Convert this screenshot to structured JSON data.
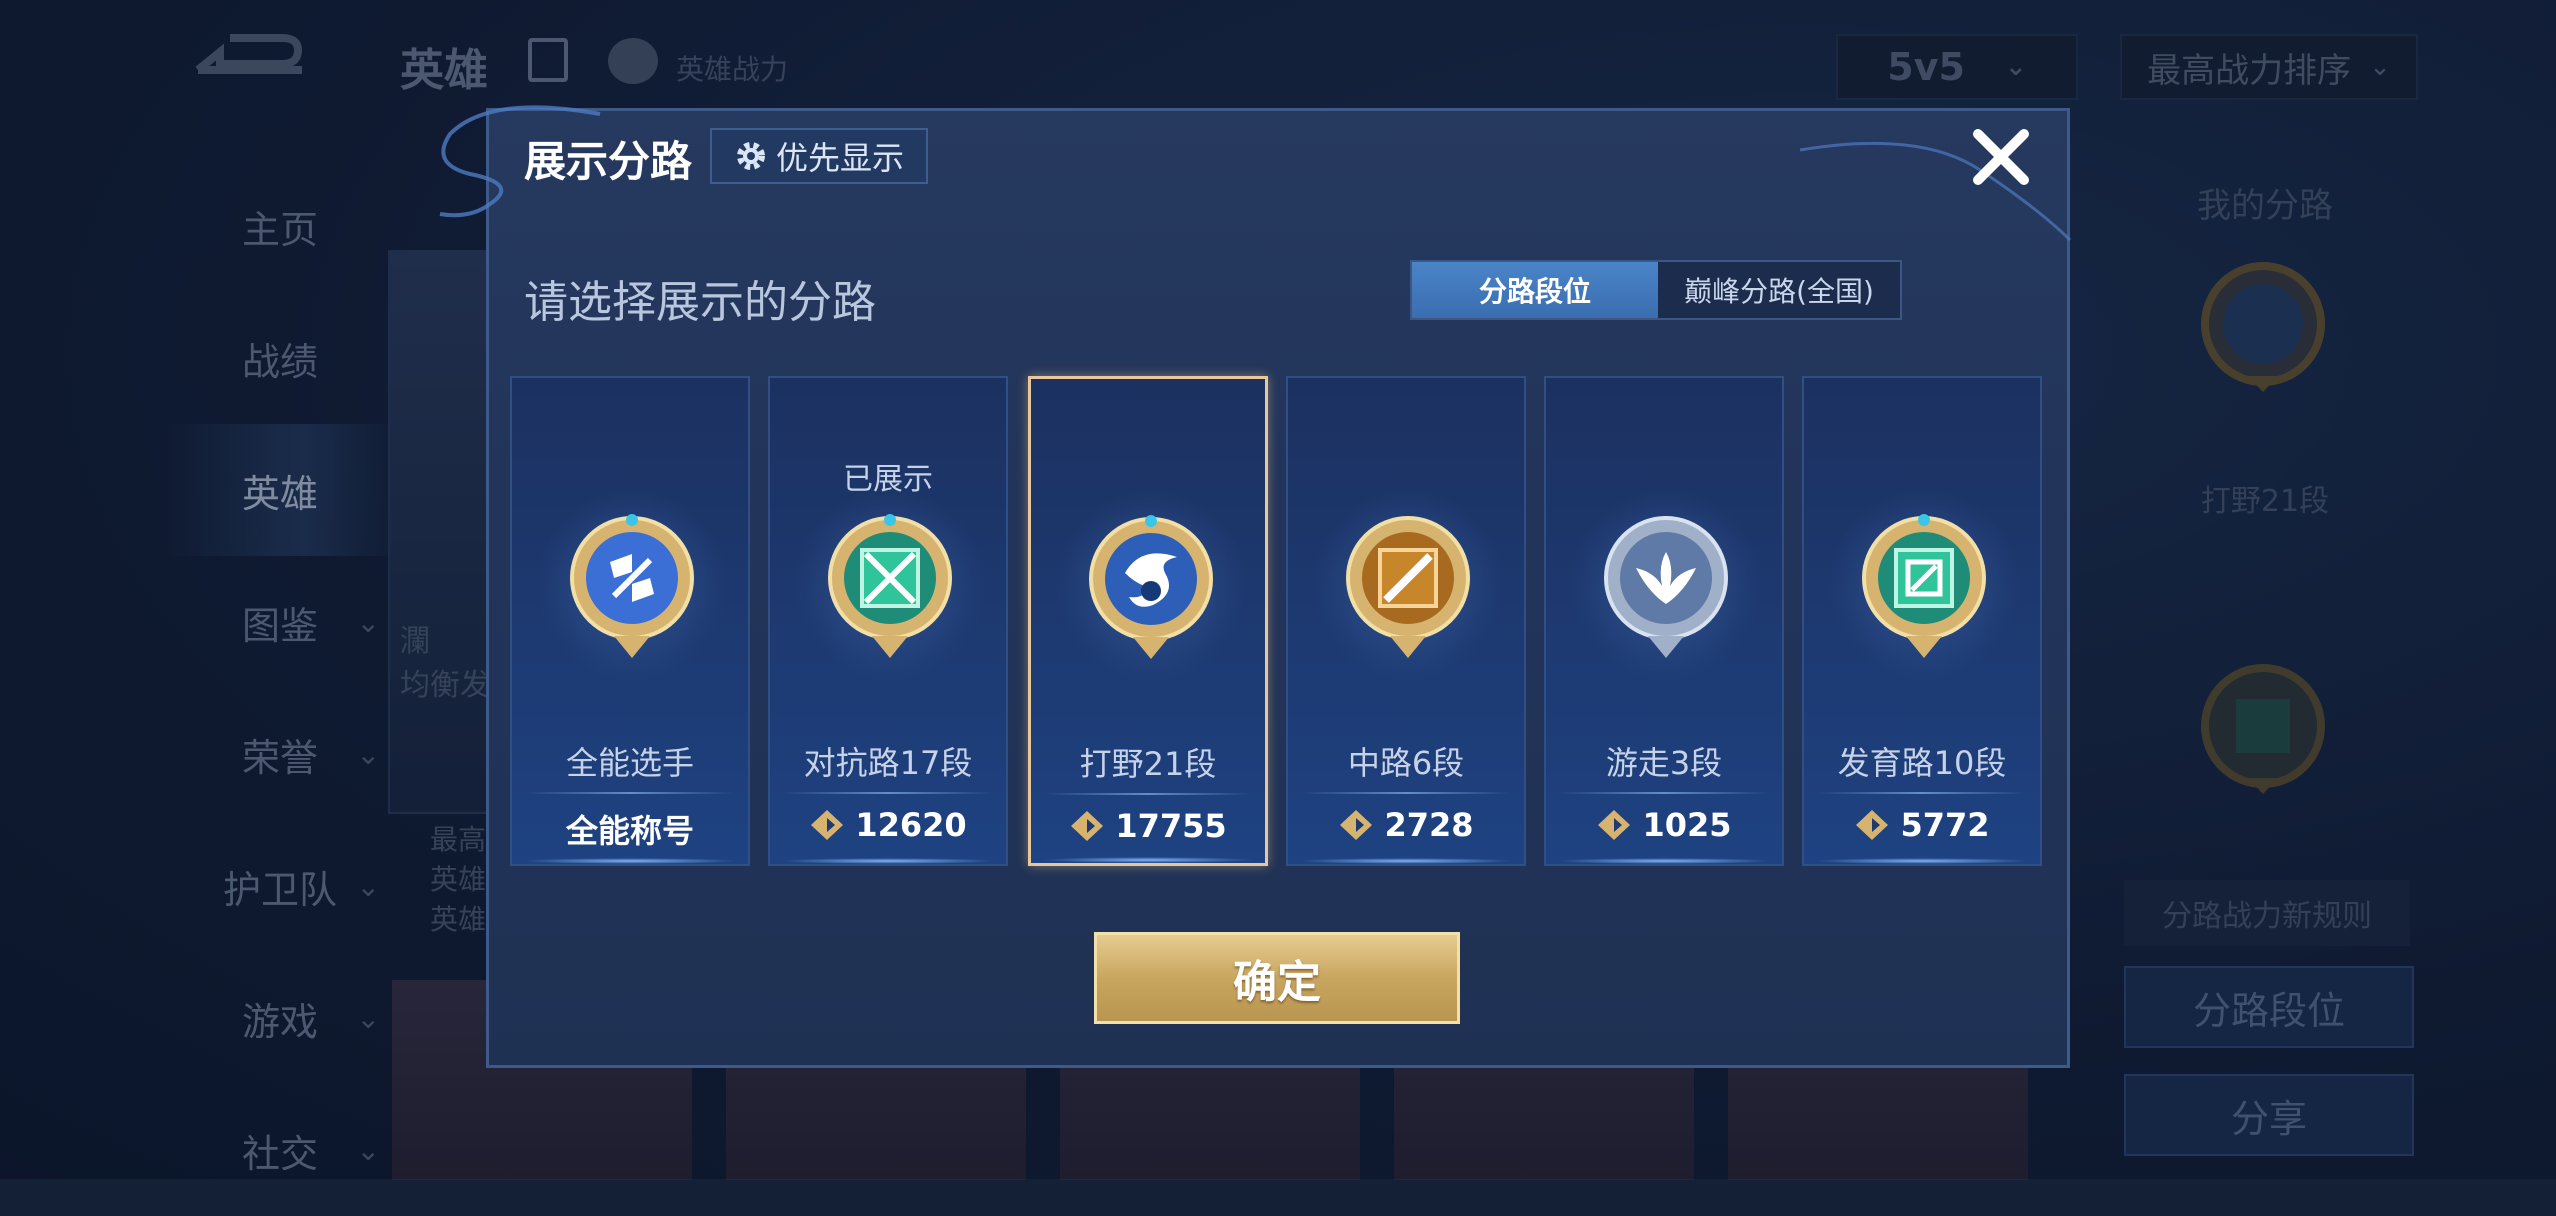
{
  "background": {
    "title": "英雄",
    "power_label": "英雄战力",
    "nav": [
      {
        "label": "主页",
        "chevron": false
      },
      {
        "label": "战绩",
        "chevron": false
      },
      {
        "label": "英雄",
        "chevron": false,
        "active": true
      },
      {
        "label": "图鉴",
        "chevron": true
      },
      {
        "label": "荣誉",
        "chevron": true
      },
      {
        "label": "护卫队",
        "chevron": true
      },
      {
        "label": "游戏",
        "chevron": true
      },
      {
        "label": "社交",
        "chevron": true
      }
    ],
    "mode_select": "5v5",
    "sort_select": "最高战力排序",
    "right_panel": {
      "title": "我的分路",
      "lane": "打野21段",
      "rule": "分路战力新规则",
      "lane_rank_button": "分路段位",
      "share_button": "分享"
    },
    "hero_card": {
      "name": "瀾",
      "tag": "均衡发",
      "lines": [
        "最高",
        "英雄",
        "英雄"
      ]
    }
  },
  "dialog": {
    "title": "展示分路",
    "priority_button": "优先显示",
    "prompt": "请选择展示的分路",
    "tabs": [
      {
        "label": "分路段位",
        "active": true
      },
      {
        "label": "巅峰分路(全国)",
        "active": false
      }
    ],
    "cards": [
      {
        "name": "全能选手",
        "score": "全能称号",
        "shown": "",
        "selected": false,
        "emblem": "all-round",
        "emblem_color": "#3b6fd6"
      },
      {
        "name": "对抗路17段",
        "score": "12620",
        "shown": "已展示",
        "selected": false,
        "emblem": "clash-lane",
        "emblem_color": "#2fc49a"
      },
      {
        "name": "打野21段",
        "score": "17755",
        "shown": "",
        "selected": true,
        "emblem": "jungle",
        "emblem_color": "#2e5fb8"
      },
      {
        "name": "中路6段",
        "score": "2728",
        "shown": "",
        "selected": false,
        "emblem": "mid-lane",
        "emblem_color": "#c8862a"
      },
      {
        "name": "游走3段",
        "score": "1025",
        "shown": "",
        "selected": false,
        "emblem": "roam",
        "emblem_color": "#8fa6c8"
      },
      {
        "name": "发育路10段",
        "score": "5772",
        "shown": "",
        "selected": false,
        "emblem": "farm-lane",
        "emblem_color": "#2fc49a"
      }
    ],
    "confirm_button": "确定"
  },
  "colors": {
    "gold": "#d6b470",
    "selected_border": "#e8c89a",
    "tab_active": "#4a84c8"
  }
}
